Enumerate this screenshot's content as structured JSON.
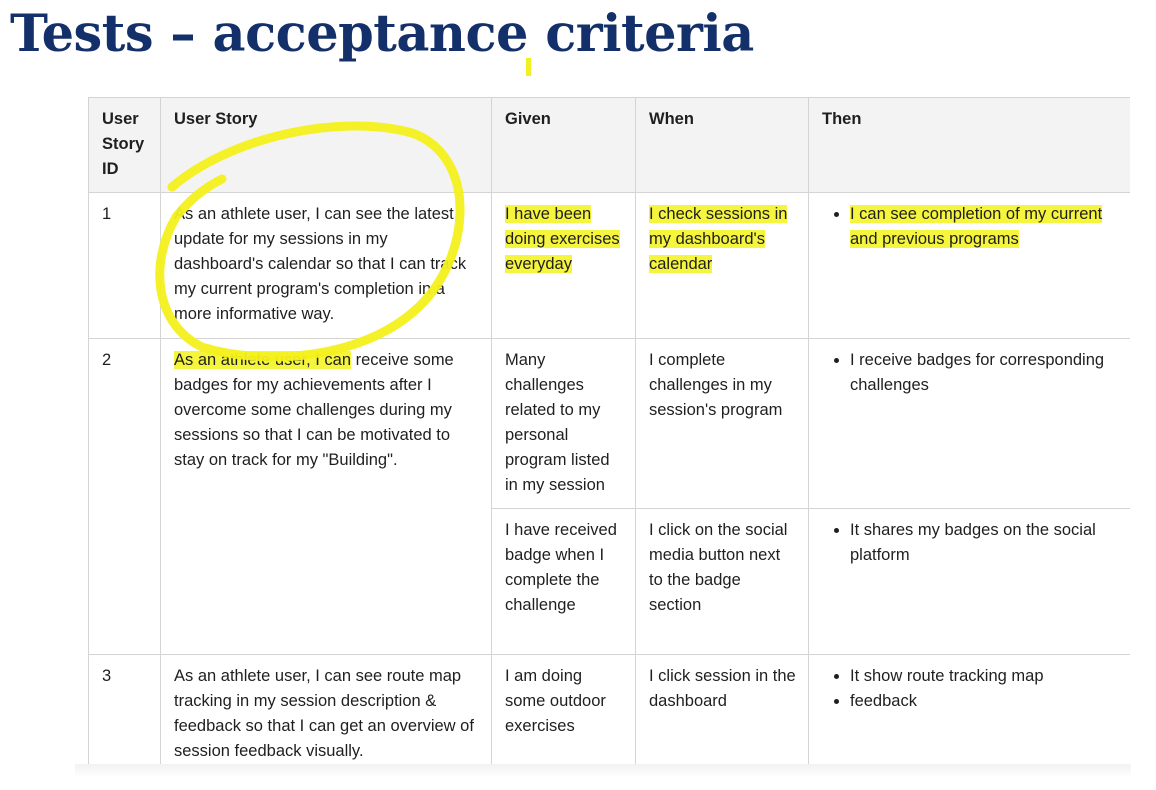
{
  "title": "Tests – acceptance criteria",
  "table": {
    "headers": {
      "id": "User Story ID",
      "story": "User Story",
      "given": "Given",
      "when": "When",
      "then": "Then"
    },
    "rows": [
      {
        "id": "1",
        "story": "As an athlete user, I can see the latest update for my sessions in my dashboard's calendar so that I can track my current program's completion in a more informative way.",
        "given": "I have been doing exercises everyday",
        "when": "I check sessions in my dashboard's calendar",
        "then": [
          "I can see completion of my current and previous programs"
        ]
      },
      {
        "id": "2",
        "story_highlighted": "As an athlete user, I can",
        "story_rest": " receive some badges for my achievements after I overcome some challenges during my sessions so that I can be motivated to stay on track for my \"Building\".",
        "given": "Many challenges related to my personal program listed in my session",
        "when": "I complete challenges in my session's program",
        "then": [
          "I receive badges for corresponding challenges"
        ]
      },
      {
        "given": "I have received badge when I complete the challenge",
        "when": "I click on the social media button next to the badge section",
        "then": [
          "It shares my badges on the social platform"
        ]
      },
      {
        "id": "3",
        "story": "As an athlete user, I can see route map tracking in my session description & feedback so that I can get an overview of session feedback visually.",
        "given": "I am doing some outdoor exercises",
        "when": "I click session in the dashboard",
        "then": [
          "It show route tracking map",
          "feedback"
        ]
      }
    ]
  },
  "highlight_color": "#f6f53d",
  "title_color": "#13306b"
}
